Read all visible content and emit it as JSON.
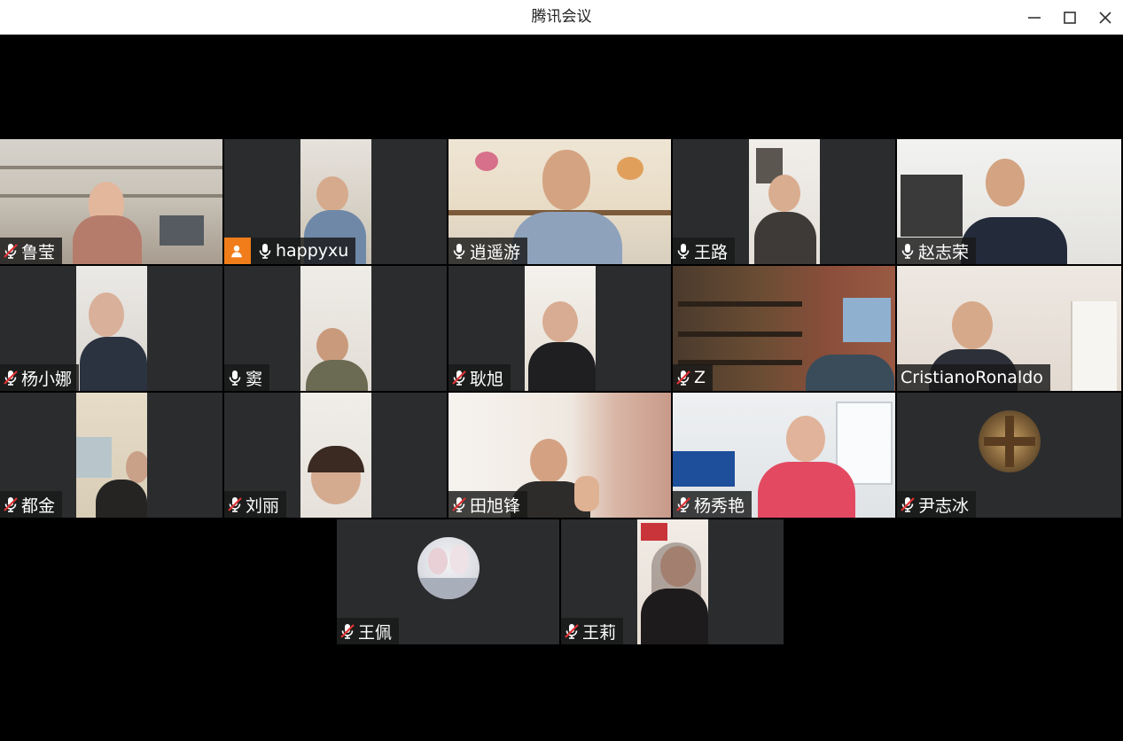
{
  "window": {
    "title": "腾讯会议"
  },
  "participants": [
    {
      "name": "鲁莹",
      "muted": true
    },
    {
      "name": "happyxu",
      "muted": false,
      "host_badge": true
    },
    {
      "name": "逍遥游",
      "muted": false,
      "speaking": true
    },
    {
      "name": "王路",
      "muted": false
    },
    {
      "name": "赵志荣",
      "muted": false
    },
    {
      "name": "杨小娜",
      "muted": true
    },
    {
      "name": "窦",
      "muted": false
    },
    {
      "name": "耿旭",
      "muted": true
    },
    {
      "name": "Z",
      "muted": true
    },
    {
      "name": "CristianoRonaldo"
    },
    {
      "name": "都金",
      "muted": true
    },
    {
      "name": "刘丽",
      "muted": true
    },
    {
      "name": "田旭锋",
      "muted": true
    },
    {
      "name": "杨秀艳",
      "muted": true
    },
    {
      "name": "尹志冰",
      "muted": true
    },
    {
      "name": "王佩",
      "muted": true
    },
    {
      "name": "王莉",
      "muted": true
    }
  ],
  "colors": {
    "tile_bg": "#2b2c2e",
    "speaking_border": "#26b05a",
    "host_badge": "#f07d1a",
    "stage_bg": "#000000"
  },
  "icons": {
    "mic": "mic-icon",
    "mic_muted": "mic-muted-icon",
    "host": "person-icon"
  }
}
